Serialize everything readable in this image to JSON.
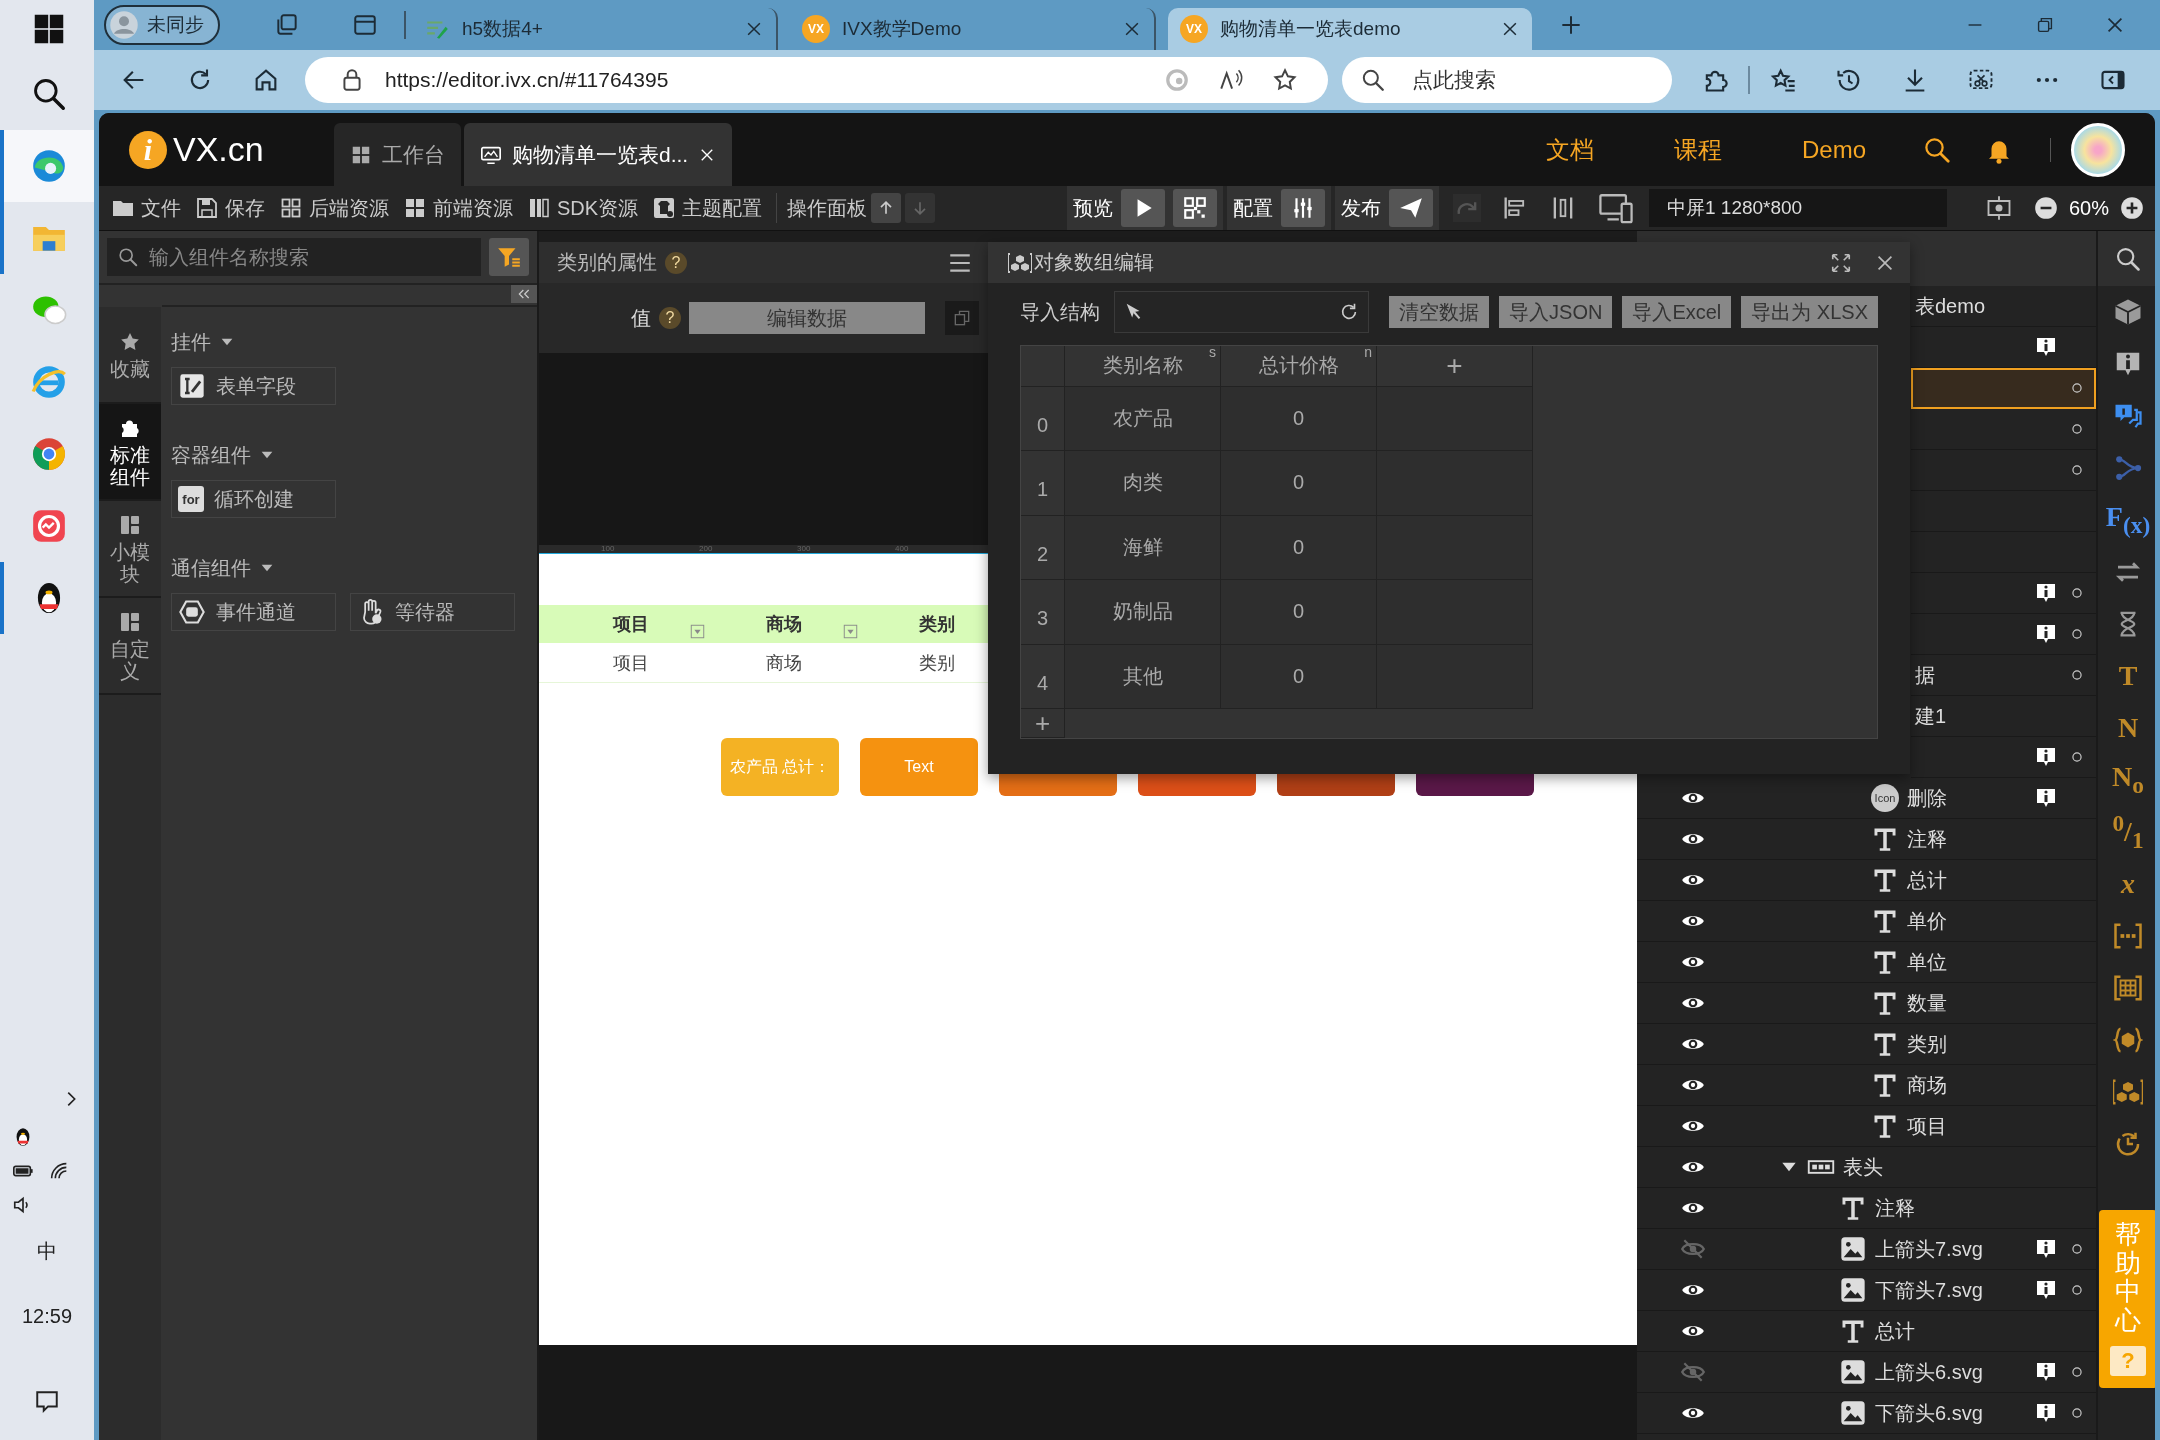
{
  "taskbar": {
    "apps": [
      {
        "kind": "windows",
        "selected": false,
        "running": false
      },
      {
        "kind": "search",
        "selected": false,
        "running": false
      },
      {
        "kind": "edge",
        "selected": true,
        "running": true
      },
      {
        "kind": "folder",
        "selected": false,
        "running": true
      },
      {
        "kind": "wechat",
        "selected": false,
        "running": false
      },
      {
        "kind": "ie",
        "selected": false,
        "running": false
      },
      {
        "kind": "chrome",
        "selected": false,
        "running": false
      },
      {
        "kind": "app",
        "selected": false,
        "running": false
      },
      {
        "kind": "qq",
        "selected": false,
        "running": true
      }
    ],
    "tray": [
      [
        {
          "kind": "chevron"
        }
      ],
      [
        {
          "kind": "qq"
        }
      ],
      [
        {
          "kind": "battery"
        },
        {
          "kind": "wifi"
        }
      ],
      [
        {
          "kind": "volume"
        }
      ]
    ],
    "ime": "中",
    "time": "12:59"
  },
  "browser": {
    "profile": "未同步",
    "tabs": [
      {
        "title": "h5数据4+",
        "kind": "sheet",
        "selected": false
      },
      {
        "title": "IVX教学Demo",
        "kind": "vx",
        "icon_text": "VX",
        "selected": false
      },
      {
        "title": "购物清单一览表demo",
        "kind": "vx",
        "icon_text": "VX",
        "selected": true
      }
    ],
    "url": "https://editor.ivx.cn/#11764395",
    "search_placeholder": "点此搜索"
  },
  "app": {
    "logo_mark": "i",
    "logo_text": "VX.cn",
    "tabs": [
      {
        "label": "工作台",
        "kind": "grid",
        "selected": false,
        "closable": false
      },
      {
        "label": "购物清单一览表d...",
        "kind": "monitor",
        "selected": true,
        "closable": true
      }
    ],
    "links": [
      "文档",
      "课程",
      "Demo"
    ],
    "toolbar": {
      "items": [
        {
          "label": "文件",
          "kind": "folder"
        },
        {
          "label": "保存",
          "kind": "save"
        },
        {
          "label": "后端资源",
          "kind": "grid_o"
        },
        {
          "label": "前端资源",
          "kind": "grid"
        },
        {
          "label": "SDK资源",
          "kind": "sdk"
        },
        {
          "label": "主题配置",
          "kind": "theme"
        }
      ],
      "panel_label": "操作面板",
      "panel_arrows": [
        {
          "kind": "up",
          "disabled": false
        },
        {
          "kind": "down",
          "disabled": true
        }
      ],
      "groups": [
        {
          "label": "预览",
          "buttons": [
            {
              "kind": "play"
            },
            {
              "kind": "qr"
            }
          ]
        },
        {
          "label": "配置",
          "buttons": [
            {
              "kind": "sliders"
            }
          ]
        },
        {
          "label": "发布",
          "buttons": [
            {
              "kind": "plane"
            }
          ]
        }
      ],
      "screen": "中屏1 1280*800",
      "zoom": "60%"
    }
  },
  "left_panel": {
    "search_placeholder": "输入组件名称搜索",
    "nav": [
      {
        "label": "收藏",
        "kind": "star",
        "selected": false
      },
      {
        "label": "标准组件",
        "kind": "puzzle",
        "selected": true
      },
      {
        "label": "小模块",
        "kind": "blocks",
        "selected": false
      },
      {
        "label": "自定义",
        "kind": "blocks",
        "selected": false
      }
    ],
    "groups": [
      {
        "title": "挂件",
        "expanded": true,
        "items": [
          {
            "label": "表单字段",
            "kind": "form"
          }
        ]
      },
      {
        "title": "容器组件",
        "expanded": true,
        "items": [
          {
            "label": "循环创建",
            "kind": "for",
            "icon_text": "for"
          }
        ]
      },
      {
        "title": "通信组件",
        "expanded": true,
        "items": [
          {
            "label": "事件通道",
            "kind": "event"
          },
          {
            "label": "等待器",
            "kind": "hand"
          }
        ]
      }
    ]
  },
  "properties": {
    "title": "类别的属性",
    "help": "?",
    "value_label": "值",
    "value_help": "?",
    "edit_button": "编辑数据"
  },
  "canvas": {
    "ruler": [
      "100",
      "200",
      "300",
      "400"
    ],
    "table": {
      "columns": [
        "项目",
        "商场",
        "类别"
      ],
      "rows": [
        [
          "项目",
          "商场",
          "类别"
        ]
      ]
    },
    "buttons": [
      {
        "label": "农产品 总计：",
        "color": "#f4b224"
      },
      {
        "label": "Text",
        "color": "#f59210"
      },
      {
        "color": "#e46e16"
      },
      {
        "color": "#dc4f18"
      },
      {
        "color": "#b03f16"
      },
      {
        "color": "#5a1848"
      }
    ]
  },
  "editor": {
    "title": "对象数组编辑",
    "import_label": "导入结构",
    "actions": [
      "清空数据",
      "导入JSON",
      "导入Excel",
      "导出为 XLSX"
    ],
    "columns": [
      {
        "label": "类别名称",
        "type": "s"
      },
      {
        "label": "总计价格",
        "type": "n"
      }
    ],
    "add_column": "+",
    "rows": [
      {
        "index": "0",
        "cells": [
          "农产品",
          "0"
        ]
      },
      {
        "index": "1",
        "cells": [
          "肉类",
          "0"
        ]
      },
      {
        "index": "2",
        "cells": [
          "海鲜",
          "0"
        ]
      },
      {
        "index": "3",
        "cells": [
          "奶制品",
          "0"
        ]
      },
      {
        "index": "4",
        "cells": [
          "其他",
          "0"
        ]
      }
    ],
    "add_row": "+"
  },
  "layers": [
    {
      "label": "表demo",
      "selected": false,
      "info": false,
      "dot": false
    },
    {
      "selected": false,
      "info": true,
      "dot": false
    },
    {
      "selected": true,
      "info": false,
      "dot": true
    },
    {
      "selected": false,
      "info": false,
      "dot": true
    },
    {
      "selected": false,
      "info": false,
      "dot": true
    },
    {
      "selected": false,
      "info": false,
      "dot": false
    },
    {
      "selected": false,
      "info": false,
      "dot": false
    },
    {
      "selected": false,
      "info": true,
      "dot": true
    },
    {
      "selected": false,
      "info": true,
      "dot": true
    },
    {
      "label": "据",
      "selected": false,
      "info": false,
      "dot": true
    },
    {
      "label": "建1",
      "selected": false,
      "info": false,
      "dot": false,
      "children": [
        {
          "selected": false,
          "info": true,
          "dot": true,
          "children": [
            {
              "label": "删除",
              "kind": "icon",
              "icon_text": "Icon",
              "visible": true,
              "selected": false,
              "info": true,
              "dot": false
            },
            {
              "label": "注释",
              "kind": "text",
              "visible": true,
              "selected": false,
              "info": false,
              "dot": false
            },
            {
              "label": "总计",
              "kind": "text",
              "visible": true,
              "selected": false,
              "info": false,
              "dot": false
            },
            {
              "label": "单价",
              "kind": "text",
              "visible": true,
              "selected": false,
              "info": false,
              "dot": false
            },
            {
              "label": "单位",
              "kind": "text",
              "visible": true,
              "selected": false,
              "info": false,
              "dot": false
            },
            {
              "label": "数量",
              "kind": "text",
              "visible": true,
              "selected": false,
              "info": false,
              "dot": false
            },
            {
              "label": "类别",
              "kind": "text",
              "visible": true,
              "selected": false,
              "info": false,
              "dot": false
            },
            {
              "label": "商场",
              "kind": "text",
              "visible": true,
              "selected": false,
              "info": false,
              "dot": false
            },
            {
              "label": "项目",
              "kind": "text",
              "visible": true,
              "selected": false,
              "info": false,
              "dot": false
            }
          ]
        }
      ]
    },
    {
      "label": "表头",
      "kind": "group",
      "expanded": true,
      "visible": true,
      "selected": false,
      "info": false,
      "dot": false,
      "children": [
        {
          "label": "注释",
          "kind": "text",
          "visible": true,
          "selected": false,
          "info": false,
          "dot": false
        },
        {
          "label": "上箭头7.svg",
          "kind": "image",
          "visible": false,
          "selected": false,
          "info": true,
          "dot": true
        },
        {
          "label": "下箭头7.svg",
          "kind": "image",
          "visible": true,
          "selected": false,
          "info": true,
          "dot": true
        },
        {
          "label": "总计",
          "kind": "text",
          "visible": true,
          "selected": false,
          "info": false,
          "dot": false
        },
        {
          "label": "上箭头6.svg",
          "kind": "image",
          "visible": false,
          "selected": false,
          "info": true,
          "dot": true
        },
        {
          "label": "下箭头6.svg",
          "kind": "image",
          "visible": true,
          "selected": false,
          "info": true,
          "dot": true
        }
      ]
    }
  ],
  "rail": [
    {
      "kind": "box",
      "color": "#9a9a9a"
    },
    {
      "kind": "info",
      "color": "#b4b4b4"
    },
    {
      "kind": "chat",
      "color": "#3d8ef0"
    },
    {
      "kind": "flow",
      "color": "#3c5fa8"
    },
    {
      "glyph": "F$_{(x)}$",
      "color": "#4a8ff0"
    },
    {
      "kind": "swap",
      "color": "#9a9a9a"
    },
    {
      "kind": "hourglass",
      "color": "#9a9a9a"
    },
    {
      "glyph": "T",
      "color": "#c08a28"
    },
    {
      "glyph": "N",
      "color": "#c08a28"
    },
    {
      "glyph": "N$_{o}$",
      "color": "#c08a28"
    },
    {
      "glyph": "$^{0}$/$_{1}$",
      "color": "#c08a28"
    },
    {
      "glyph": "*x*",
      "color": "#c08a28"
    },
    {
      "kind": "brdots",
      "color": "#c08a28"
    },
    {
      "kind": "brgrid",
      "color": "#c08a28"
    },
    {
      "kind": "brcube",
      "color": "#c08a28"
    },
    {
      "kind": "brcubes",
      "color": "#c08a28"
    },
    {
      "kind": "clock",
      "color": "#c08a28"
    }
  ],
  "help_center": {
    "label": "帮助中心",
    "mark": "?"
  }
}
